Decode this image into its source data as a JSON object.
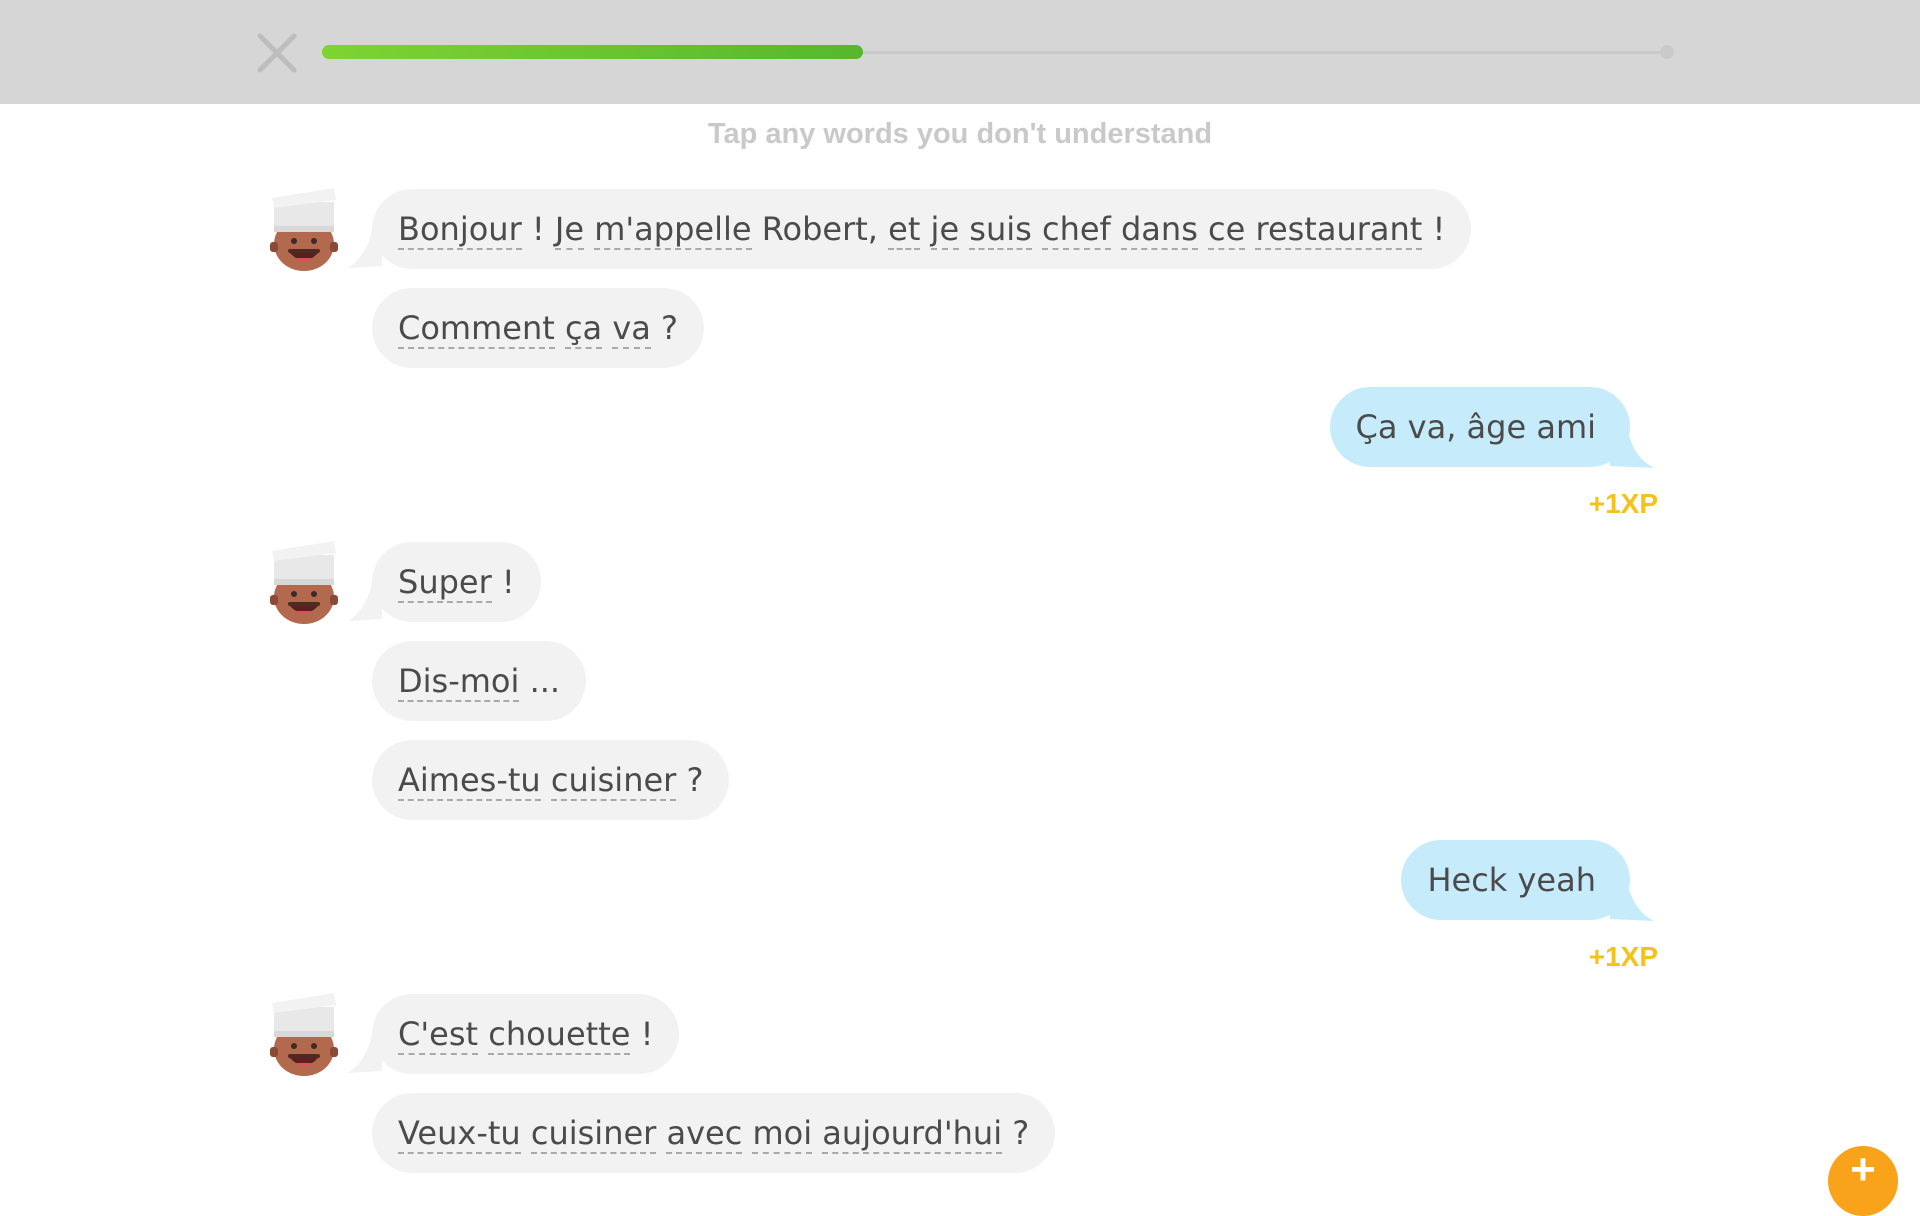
{
  "header": {
    "close_icon": "close-x-icon",
    "progress": 0.4,
    "progress_color": "#58cc02"
  },
  "hint": "Tap any words you don't understand",
  "chat": {
    "group1": {
      "m1": [
        "Bonjour",
        " ! ",
        "Je",
        " ",
        "m'appelle",
        " Robert, ",
        "et",
        " ",
        "je",
        " ",
        "suis",
        " ",
        "chef",
        " ",
        "dans",
        " ",
        "ce",
        " ",
        "restaurant",
        " !"
      ],
      "m2": [
        "Comment",
        " ",
        "ça",
        " ",
        "va",
        " ?"
      ]
    },
    "reply1": "Ça va, âge ami",
    "xp1": "+1XP",
    "group2": {
      "m1": [
        "Super",
        " !"
      ],
      "m2": [
        "Dis-moi",
        " ..."
      ],
      "m3": [
        "Aimes-tu",
        " ",
        "cuisiner",
        " ?"
      ]
    },
    "reply2": "Heck yeah",
    "xp2": "+1XP",
    "group3": {
      "m1": [
        "C'est",
        " ",
        "chouette",
        " !"
      ],
      "m2": [
        "Veux-tu",
        " ",
        "cuisiner",
        " ",
        "avec",
        " ",
        "moi",
        " ",
        "aujourd'hui",
        " ?"
      ]
    }
  },
  "fab": {
    "icon": "plus-icon",
    "color": "#f9a31b"
  }
}
